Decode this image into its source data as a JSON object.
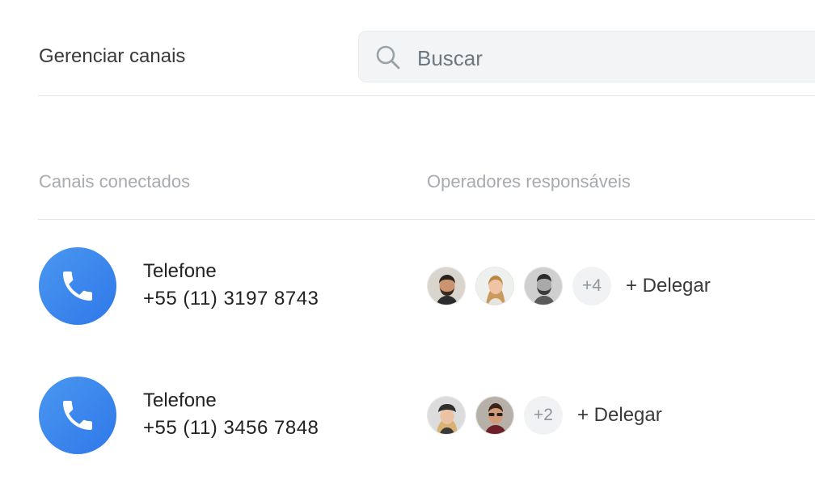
{
  "header": {
    "title": "Gerenciar canais"
  },
  "search": {
    "placeholder": "Buscar"
  },
  "columns": {
    "channels": "Canais conectados",
    "operators": "Operadores responsáveis"
  },
  "channels": [
    {
      "name": "Telefone",
      "number": "+55 (11) 3197 8743",
      "icon": "phone-icon",
      "avatars": [
        "operator-avatar",
        "operator-avatar",
        "operator-avatar"
      ],
      "more": "+4",
      "delegate_label": "+ Delegar"
    },
    {
      "name": "Telefone",
      "number": "+55 (11) 3456 7848",
      "icon": "phone-icon",
      "avatars": [
        "operator-avatar",
        "operator-avatar"
      ],
      "more": "+2",
      "delegate_label": "+ Delegar"
    }
  ],
  "colors": {
    "accent": "#3483ec",
    "muted": "#a7abaf",
    "search_bg": "#f2f4f5"
  }
}
